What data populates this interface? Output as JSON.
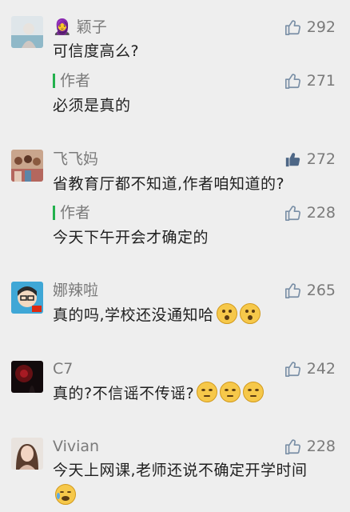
{
  "comments": [
    {
      "author": "🧕 颖子",
      "text": "可信度高么?",
      "likes": "292",
      "reply": {
        "author": "作者",
        "text": "必须是真的",
        "likes": "271"
      }
    },
    {
      "author": "飞飞妈",
      "text": "省教育厅都不知道,作者咱知道的?",
      "likes": "272",
      "liked": true,
      "reply": {
        "author": "作者",
        "text": "今天下午开会才确定的",
        "likes": "228"
      }
    },
    {
      "author": "娜辣啦",
      "text": "真的吗,学校还没通知哈",
      "likes": "265"
    },
    {
      "author": "C7",
      "text": "真的?不信谣不传谣?",
      "likes": "242"
    },
    {
      "author": "Vivian",
      "text": "今天上网课,老师还说不确定开学时间",
      "likes": "228"
    }
  ]
}
